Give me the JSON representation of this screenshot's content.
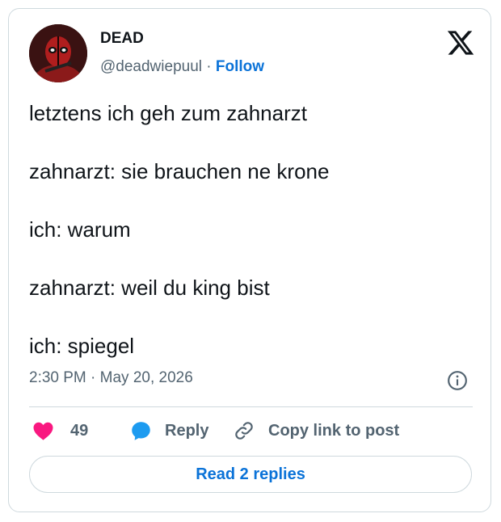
{
  "user": {
    "name": "DEAD",
    "handle": "@deadwiepuul",
    "separator": "·",
    "follow_label": "Follow"
  },
  "post": {
    "lines": [
      "letztens ich geh zum zahnarzt",
      "zahnarzt: sie brauchen ne krone",
      "ich: warum",
      "zahnarzt: weil du king bist",
      "ich: spiegel"
    ],
    "timestamp": "2:30 PM · May 20, 2026"
  },
  "actions": {
    "like_count": "49",
    "reply_label": "Reply",
    "copy_label": "Copy link to post"
  },
  "read_replies_label": "Read 2 replies",
  "icons": {
    "logo": "x-logo-icon",
    "info": "info-icon",
    "like": "heart-icon",
    "reply": "speech-bubble-icon",
    "copy": "link-icon"
  },
  "colors": {
    "accent": "#0b73d8",
    "like": "#f91880",
    "reply": "#1d9bf0",
    "muted": "#536471",
    "border": "#cfd9de"
  }
}
